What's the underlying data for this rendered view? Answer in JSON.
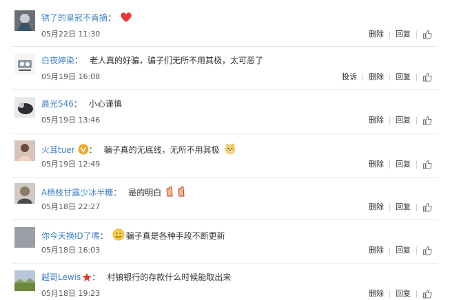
{
  "actions": {
    "delete": "删除",
    "reply": "回复",
    "report": "投诉",
    "like_icon": "thumbs-up-icon"
  },
  "comments": [
    {
      "user": "锈了的皇冠不肯摘",
      "text": "",
      "emoji": "heart-emoji",
      "time": "05月22日 11:30",
      "badge": ""
    },
    {
      "user": "白夜婷染",
      "text": "老人真的好骗，骗子们无所不用其极，太可恶了",
      "emoji": "",
      "time": "05月19日 16:08",
      "badge": ""
    },
    {
      "user": "晨光546",
      "text": "小心谨慎",
      "emoji": "",
      "time": "05月19日 13:46",
      "badge": ""
    },
    {
      "user": "火耳tuer",
      "text": "骗子真的无底线，无所不用其极",
      "emoji": "doge-emoji",
      "time": "05月19日 12:49",
      "badge": "verified-v-badge"
    },
    {
      "user": "A杨枝甘露少冰半糖",
      "text": "是的明白",
      "emoji": "clap-emoji",
      "time": "05月18日 22:27",
      "badge": ""
    },
    {
      "user": "你今天换ID了嗎",
      "text": "骗子真是各种手段不断更新",
      "emoji": "smile-emoji",
      "time": "05月18日 16:03",
      "badge": ""
    },
    {
      "user": "越哥Lewis",
      "text": "村镇银行的存款什么时候能取出来",
      "emoji": "",
      "time": "05月18日 19:23",
      "badge": "red-star-badge"
    }
  ],
  "colors": {
    "username": "#3c82c8",
    "text": "#333333",
    "separator": "#e6e6e6",
    "heart": "#e8383d"
  }
}
